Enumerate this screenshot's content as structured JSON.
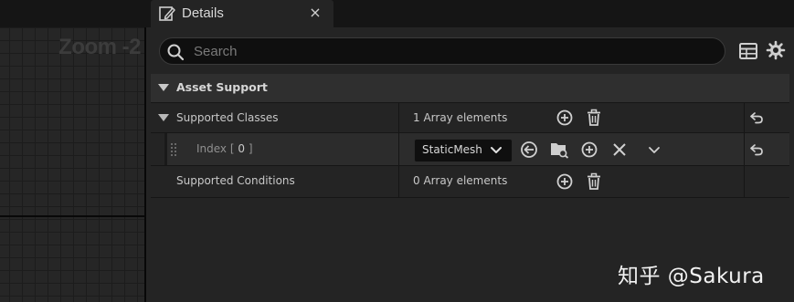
{
  "viewport": {
    "zoom_label": "Zoom -2"
  },
  "tab": {
    "title": "Details",
    "icon": "pencil-icon",
    "close_glyph": "×"
  },
  "search": {
    "placeholder": "Search",
    "value": ""
  },
  "toolbar": {
    "table_icon": "table-icon",
    "settings_icon": "gear-icon"
  },
  "category": {
    "label": "Asset Support"
  },
  "rows": {
    "supported_classes": {
      "label": "Supported Classes",
      "value": "1 Array elements"
    },
    "index": {
      "prefix": "Index [ ",
      "number": "0",
      "suffix": " ]",
      "class_value": "StaticMesh"
    },
    "supported_conditions": {
      "label": "Supported Conditions",
      "value": "0 Array elements"
    }
  },
  "watermark": "知乎 @Sakura",
  "colors": {
    "panel_bg": "#242424",
    "header_bg": "#2f2f2f",
    "field_bg": "#0f0f0f",
    "text": "#c8c8c8"
  }
}
